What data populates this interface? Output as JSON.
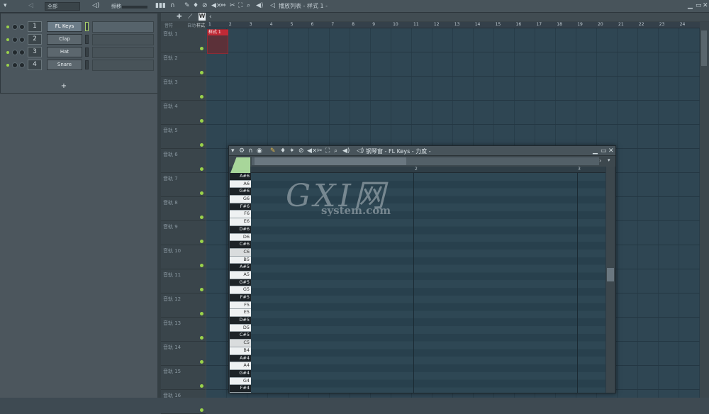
{
  "toolbar": {
    "filter_value": "全部",
    "pitch_label": "频移",
    "playlist_title": "播放列表 - 样式 1 -"
  },
  "channel_rack": {
    "add_label": "+",
    "channels": [
      {
        "num": "1",
        "name": "FL Keys",
        "selected": true
      },
      {
        "num": "2",
        "name": "Clap"
      },
      {
        "num": "3",
        "name": "Hat"
      },
      {
        "num": "4",
        "name": "Snare"
      }
    ]
  },
  "playlist": {
    "subhead": {
      "a": "音符",
      "b": "自动",
      "c": "样式"
    },
    "bar_numbers": [
      "1",
      "2",
      "3",
      "4",
      "5",
      "6",
      "7",
      "8",
      "9",
      "10",
      "11",
      "12",
      "13",
      "14",
      "15",
      "16",
      "17",
      "18",
      "19",
      "20",
      "21",
      "22",
      "23",
      "24"
    ],
    "tracks": [
      "音轨 1",
      "音轨 2",
      "音轨 3",
      "音轨 4",
      "音轨 5",
      "音轨 6",
      "音轨 7",
      "音轨 8",
      "音轨 9",
      "音轨 10",
      "音轨 11",
      "音轨 12",
      "音轨 13",
      "音轨 14",
      "音轨 15",
      "音轨 16"
    ],
    "pattern_clip_label": "样式 1"
  },
  "piano_roll": {
    "title": "钢琴窗 - FL Keys - 力度 -",
    "bar_numbers": [
      "2",
      "3"
    ],
    "keys": [
      {
        "label": "A#6",
        "type": "b"
      },
      {
        "label": "A6",
        "type": "w"
      },
      {
        "label": "G#6",
        "type": "b"
      },
      {
        "label": "G6",
        "type": "w"
      },
      {
        "label": "F#6",
        "type": "b"
      },
      {
        "label": "F6",
        "type": "w"
      },
      {
        "label": "E6",
        "type": "w"
      },
      {
        "label": "D#6",
        "type": "b"
      },
      {
        "label": "D6",
        "type": "w"
      },
      {
        "label": "C#6",
        "type": "b"
      },
      {
        "label": "C6",
        "type": "c"
      },
      {
        "label": "B5",
        "type": "w"
      },
      {
        "label": "A#5",
        "type": "b"
      },
      {
        "label": "A5",
        "type": "w"
      },
      {
        "label": "G#5",
        "type": "b"
      },
      {
        "label": "G5",
        "type": "w"
      },
      {
        "label": "F#5",
        "type": "b"
      },
      {
        "label": "F5",
        "type": "w"
      },
      {
        "label": "E5",
        "type": "w"
      },
      {
        "label": "D#5",
        "type": "b"
      },
      {
        "label": "D5",
        "type": "w"
      },
      {
        "label": "C#5",
        "type": "b"
      },
      {
        "label": "C5",
        "type": "c"
      },
      {
        "label": "B4",
        "type": "w"
      },
      {
        "label": "A#4",
        "type": "b"
      },
      {
        "label": "A4",
        "type": "w"
      },
      {
        "label": "G#4",
        "type": "b"
      },
      {
        "label": "G4",
        "type": "w"
      },
      {
        "label": "F#4",
        "type": "b"
      }
    ]
  },
  "watermark": {
    "big": "GXI网",
    "small": "system.com"
  }
}
